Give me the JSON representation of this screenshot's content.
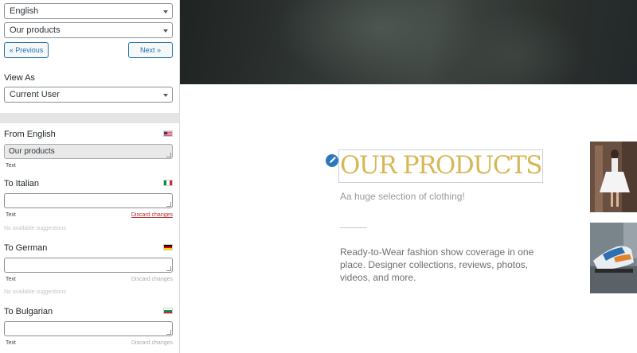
{
  "sidebar": {
    "language_select": {
      "value": "English"
    },
    "page_select": {
      "value": "Our products"
    },
    "prev_button": "« Previous",
    "next_button": "Next »",
    "view_as": {
      "label": "View As",
      "value": "Current User"
    },
    "source": {
      "label": "From English",
      "value": "Our products",
      "type": "Text"
    },
    "translations": [
      {
        "label": "To Italian",
        "value": "",
        "type": "Text",
        "discard": "Discard changes",
        "suggestions": "No available suggestions"
      },
      {
        "label": "To German",
        "value": "",
        "type": "Text",
        "discard": "Discard changes",
        "suggestions": "No available suggestions"
      },
      {
        "label": "To Bulgarian",
        "value": "",
        "type": "Text",
        "discard": "Discard changes"
      }
    ]
  },
  "main": {
    "title": "OUR PRODUCTS",
    "subtitle": "Aa huge selection of clothing!",
    "body": "Ready-to-Wear fashion show coverage in one place. Designer collections, reviews, photos, videos, and more."
  },
  "colors": {
    "title": "#d7b755",
    "arrow": "#e8141c",
    "link": "#2271b1",
    "discard_active": "#b32d2e",
    "edit_badge": "#2b78bd"
  },
  "icons": {
    "edit": "pencil-icon",
    "flags": [
      "us-flag-icon",
      "italy-flag-icon",
      "germany-flag-icon",
      "bulgaria-flag-icon"
    ]
  }
}
